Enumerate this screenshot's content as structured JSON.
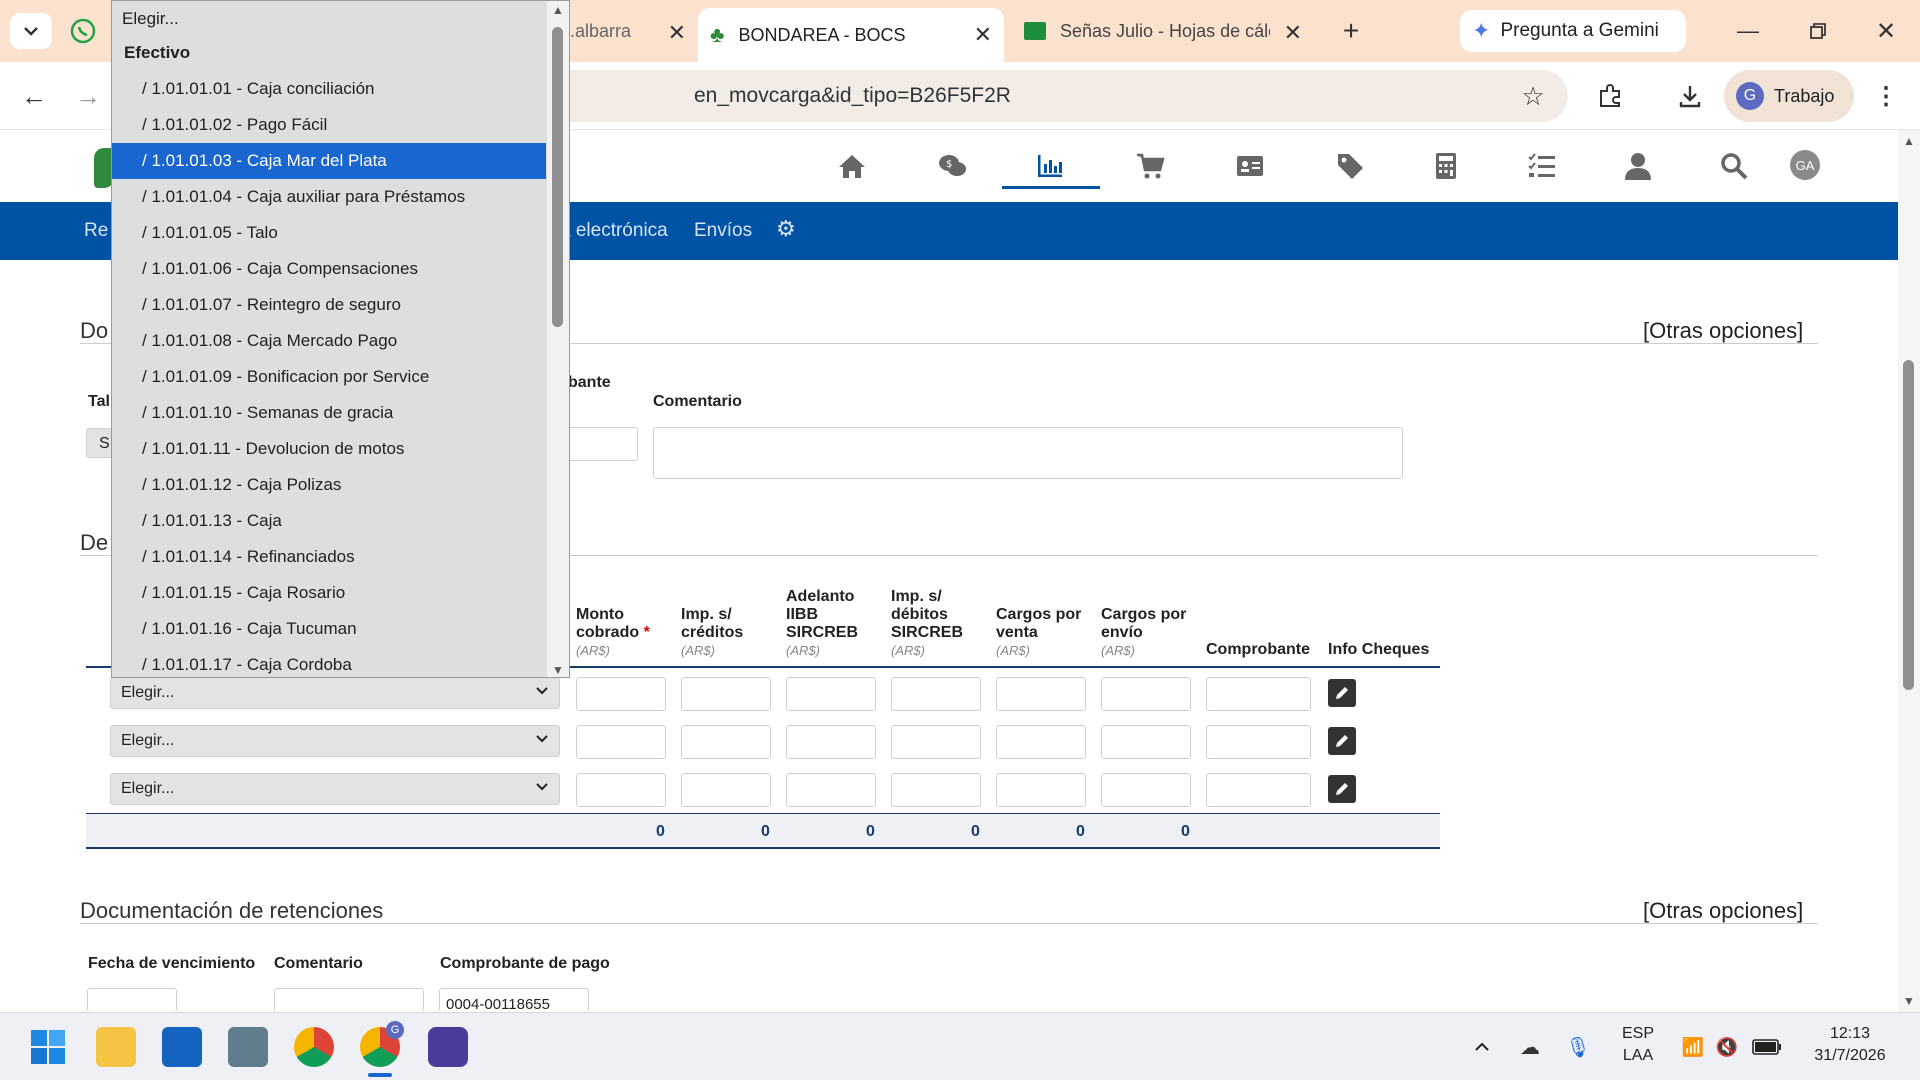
{
  "browser": {
    "tabs": [
      {
        "label": "g.albarra"
      },
      {
        "label": "BONDAREA - BOCS"
      },
      {
        "label": "Señas Julio - Hojas de cálc"
      }
    ],
    "gemini_label": "Pregunta a Gemini",
    "url_fragment": "en_movcarga&id_tipo=B26F5F2R",
    "profile_label": "Trabajo",
    "profile_initial": "G"
  },
  "header": {
    "avatar_initials": "GA",
    "nav_icons": [
      "home-icon",
      "money-chat-icon",
      "chart-icon",
      "cart-icon",
      "id-card-icon",
      "tag-icon",
      "calculator-icon",
      "checklist-icon",
      "user-icon",
      "search-icon"
    ]
  },
  "navbar": {
    "items": [
      "Re",
      "a electrónica",
      "Envíos"
    ]
  },
  "section1": {
    "title": "Do",
    "otras": "[Otras opciones]",
    "label_tal": "Tal",
    "label_comprobante": "bante",
    "label_comentario": "Comentario",
    "select_partial": "S"
  },
  "section2": {
    "title": "De",
    "headers": [
      {
        "label": "Monto cobrado",
        "unit": "(AR$)"
      },
      {
        "label": "Imp. s/ créditos",
        "unit": "(AR$)"
      },
      {
        "label": "Adelanto IIBB SIRCREB",
        "unit": "(AR$)"
      },
      {
        "label": "Imp. s/ débitos SIRCREB",
        "unit": "(AR$)"
      },
      {
        "label": "Cargos por venta",
        "unit": "(AR$)"
      },
      {
        "label": "Cargos por envío",
        "unit": "(AR$)"
      },
      {
        "label": "Comprobante",
        "unit": ""
      },
      {
        "label": "Info Cheques",
        "unit": ""
      }
    ],
    "required_mark": "*",
    "rows": [
      {
        "select": "Elegir..."
      },
      {
        "select": "Elegir..."
      },
      {
        "select": "Elegir..."
      }
    ],
    "totals": [
      "0",
      "0",
      "0",
      "0",
      "0",
      "0"
    ]
  },
  "section3": {
    "title": "Documentación de retenciones",
    "otras": "[Otras opciones]",
    "label_fecha": "Fecha de vencimiento",
    "label_comentario": "Comentario",
    "label_comprobante": "Comprobante de pago",
    "comprobante_value": "0004-00118655"
  },
  "dropdown": {
    "first": "Elegir...",
    "group": "Efectivo",
    "selected_index": 2,
    "items": [
      "/ 1.01.01.01 - Caja conciliación",
      "/ 1.01.01.02 - Pago Fácil",
      "/ 1.01.01.03 - Caja Mar del Plata",
      "/ 1.01.01.04 - Caja auxiliar para Préstamos",
      "/ 1.01.01.05 - Talo",
      "/ 1.01.01.06 - Caja Compensaciones",
      "/ 1.01.01.07 - Reintegro de seguro",
      "/ 1.01.01.08 - Caja Mercado Pago",
      "/ 1.01.01.09 - Bonificacion por Service",
      "/ 1.01.01.10 - Semanas de gracia",
      "/ 1.01.01.11 - Devolucion de motos",
      "/ 1.01.01.12 - Caja Polizas",
      "/ 1.01.01.13 - Caja",
      "/ 1.01.01.14 - Refinanciados",
      "/ 1.01.01.15 - Caja Rosario",
      "/ 1.01.01.16 - Caja Tucuman",
      "/ 1.01.01.17 - Caja Cordoba"
    ]
  },
  "taskbar": {
    "lang_line1": "ESP",
    "lang_line2": "LAA",
    "time": "12:13",
    "date": "31/7/2026",
    "chrome_badge": "G"
  },
  "colors": {
    "navbar": "#0052a5",
    "selected": "#1a66d1",
    "tabbar": "#fbe2cf"
  }
}
